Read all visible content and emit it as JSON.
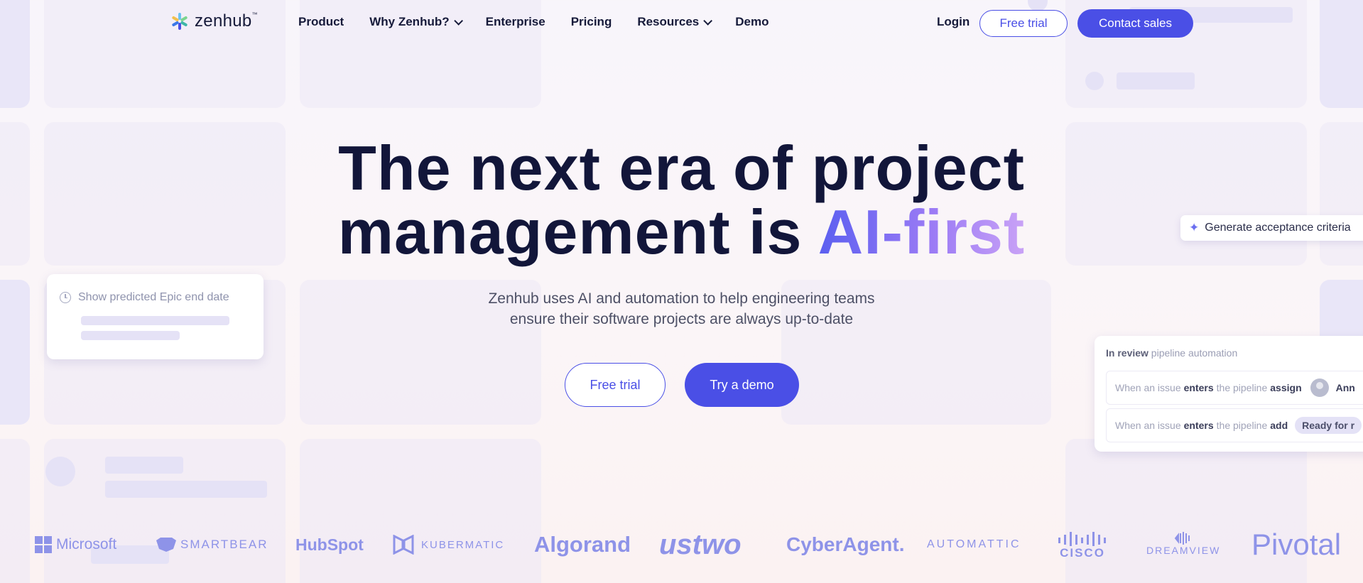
{
  "brand": {
    "name": "zenhub",
    "trademark": "™"
  },
  "nav": {
    "items": [
      {
        "label": "Product"
      },
      {
        "label": "Why Zenhub?"
      },
      {
        "label": "Enterprise"
      },
      {
        "label": "Pricing"
      },
      {
        "label": "Resources"
      },
      {
        "label": "Demo"
      }
    ],
    "login": "Login",
    "free_trial": "Free trial",
    "contact_sales": "Contact sales"
  },
  "hero": {
    "title_line1": "The next era of project",
    "title_line2_plain": "management is ",
    "title_line2_accent": "AI-first",
    "subtitle_line1": "Zenhub uses AI and automation to help engineering teams",
    "subtitle_line2": "ensure their software projects are always up-to-date",
    "cta_free_trial": "Free trial",
    "cta_demo": "Try a demo"
  },
  "cards": {
    "epic": {
      "label": "Show predicted Epic end date"
    },
    "generate": {
      "label": "Generate acceptance criteria"
    },
    "review": {
      "title_bold": "In review",
      "title_rest": " pipeline automation",
      "row1": {
        "pre": "When an issue",
        "verb": "enters",
        "mid": "the pipeline",
        "action": "assign",
        "who": "Ann"
      },
      "row2": {
        "pre": "When an issue",
        "verb": "enters",
        "mid": "the pipeline",
        "action": "add",
        "tag": "Ready for r"
      }
    }
  },
  "logos": [
    "Microsoft",
    "SMARTBEAR",
    "HubSpot",
    "KUBERMATIC",
    "Algorand",
    "ustwo",
    "CyberAgent.",
    "AUTOMATTIC",
    "CISCO",
    "DREAMVIEW",
    "Pivotal"
  ],
  "colors": {
    "accent": "#4a4fe6",
    "heading": "#12163a",
    "logo": "#8e93e8"
  }
}
